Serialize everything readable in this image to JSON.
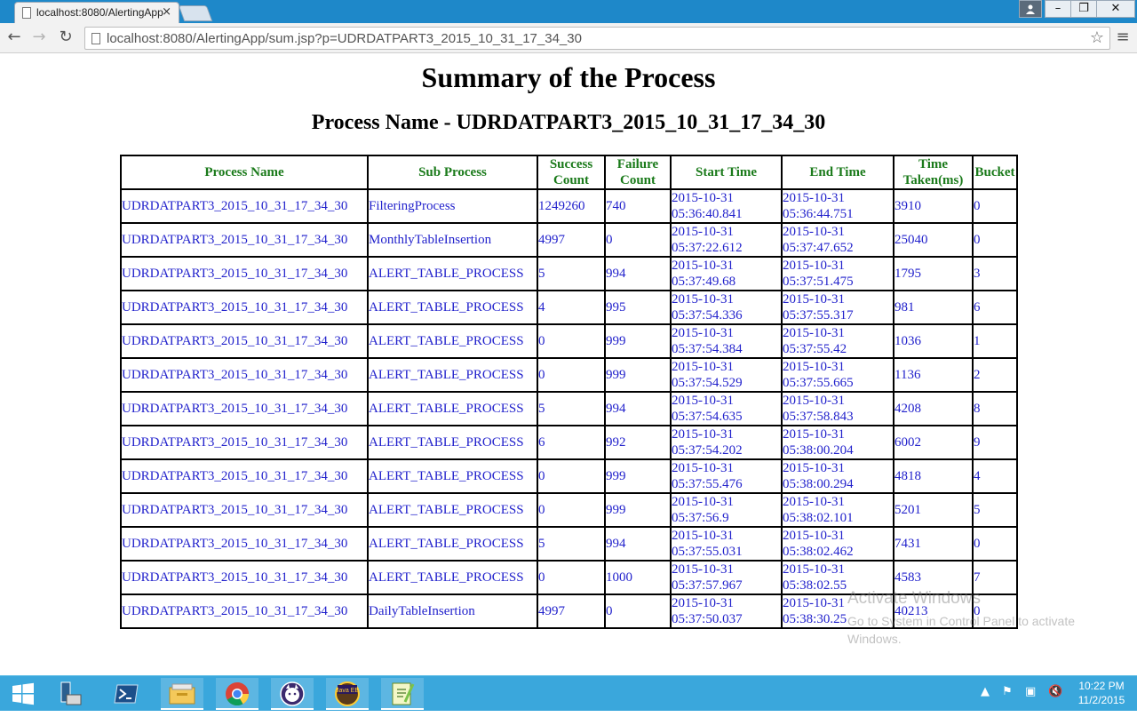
{
  "browser": {
    "tab_title": "localhost:8080/AlertingApp",
    "tab_close": "×",
    "address": "localhost:8080/AlertingApp/sum.jsp?p=UDRDATPART3_2015_10_31_17_34_30",
    "window_controls": {
      "minimize": "–",
      "maximize": "❐",
      "close": "✕"
    },
    "icons": [
      "back-icon",
      "forward-icon",
      "reload-icon",
      "star-icon",
      "menu-icon"
    ]
  },
  "page": {
    "title": "Summary of the Process",
    "subtitle": "Process Name - UDRDATPART3_2015_10_31_17_34_30"
  },
  "table": {
    "headers": [
      "Process Name",
      "Sub Process",
      "Success Count",
      "Failure Count",
      "Start Time",
      "End Time",
      "Time Taken(ms)",
      "Bucket"
    ],
    "header_lines": [
      [
        "Process Name"
      ],
      [
        "Sub Process"
      ],
      [
        "Success",
        "Count"
      ],
      [
        "Failure",
        "Count"
      ],
      [
        "Start Time"
      ],
      [
        "End Time"
      ],
      [
        "Time",
        "Taken(ms)"
      ],
      [
        "Bucket"
      ]
    ],
    "rows": [
      {
        "process": "UDRDATPART3_2015_10_31_17_34_30",
        "sub": "FilteringProcess",
        "success": "1249260",
        "failure": "740",
        "start_date": "2015-10-31",
        "start_time": "05:36:40.841",
        "end_date": "2015-10-31",
        "end_time": "05:36:44.751",
        "taken": "3910",
        "bucket": "0"
      },
      {
        "process": "UDRDATPART3_2015_10_31_17_34_30",
        "sub": "MonthlyTableInsertion",
        "success": "4997",
        "failure": "0",
        "start_date": "2015-10-31",
        "start_time": "05:37:22.612",
        "end_date": "2015-10-31",
        "end_time": "05:37:47.652",
        "taken": "25040",
        "bucket": "0"
      },
      {
        "process": "UDRDATPART3_2015_10_31_17_34_30",
        "sub": "ALERT_TABLE_PROCESS",
        "success": "5",
        "failure": "994",
        "start_date": "2015-10-31",
        "start_time": "05:37:49.68",
        "end_date": "2015-10-31",
        "end_time": "05:37:51.475",
        "taken": "1795",
        "bucket": "3"
      },
      {
        "process": "UDRDATPART3_2015_10_31_17_34_30",
        "sub": "ALERT_TABLE_PROCESS",
        "success": "4",
        "failure": "995",
        "start_date": "2015-10-31",
        "start_time": "05:37:54.336",
        "end_date": "2015-10-31",
        "end_time": "05:37:55.317",
        "taken": "981",
        "bucket": "6"
      },
      {
        "process": "UDRDATPART3_2015_10_31_17_34_30",
        "sub": "ALERT_TABLE_PROCESS",
        "success": "0",
        "failure": "999",
        "start_date": "2015-10-31",
        "start_time": "05:37:54.384",
        "end_date": "2015-10-31",
        "end_time": "05:37:55.42",
        "taken": "1036",
        "bucket": "1"
      },
      {
        "process": "UDRDATPART3_2015_10_31_17_34_30",
        "sub": "ALERT_TABLE_PROCESS",
        "success": "0",
        "failure": "999",
        "start_date": "2015-10-31",
        "start_time": "05:37:54.529",
        "end_date": "2015-10-31",
        "end_time": "05:37:55.665",
        "taken": "1136",
        "bucket": "2"
      },
      {
        "process": "UDRDATPART3_2015_10_31_17_34_30",
        "sub": "ALERT_TABLE_PROCESS",
        "success": "5",
        "failure": "994",
        "start_date": "2015-10-31",
        "start_time": "05:37:54.635",
        "end_date": "2015-10-31",
        "end_time": "05:37:58.843",
        "taken": "4208",
        "bucket": "8"
      },
      {
        "process": "UDRDATPART3_2015_10_31_17_34_30",
        "sub": "ALERT_TABLE_PROCESS",
        "success": "6",
        "failure": "992",
        "start_date": "2015-10-31",
        "start_time": "05:37:54.202",
        "end_date": "2015-10-31",
        "end_time": "05:38:00.204",
        "taken": "6002",
        "bucket": "9"
      },
      {
        "process": "UDRDATPART3_2015_10_31_17_34_30",
        "sub": "ALERT_TABLE_PROCESS",
        "success": "0",
        "failure": "999",
        "start_date": "2015-10-31",
        "start_time": "05:37:55.476",
        "end_date": "2015-10-31",
        "end_time": "05:38:00.294",
        "taken": "4818",
        "bucket": "4"
      },
      {
        "process": "UDRDATPART3_2015_10_31_17_34_30",
        "sub": "ALERT_TABLE_PROCESS",
        "success": "0",
        "failure": "999",
        "start_date": "2015-10-31",
        "start_time": "05:37:56.9",
        "end_date": "2015-10-31",
        "end_time": "05:38:02.101",
        "taken": "5201",
        "bucket": "5"
      },
      {
        "process": "UDRDATPART3_2015_10_31_17_34_30",
        "sub": "ALERT_TABLE_PROCESS",
        "success": "5",
        "failure": "994",
        "start_date": "2015-10-31",
        "start_time": "05:37:55.031",
        "end_date": "2015-10-31",
        "end_time": "05:38:02.462",
        "taken": "7431",
        "bucket": "0"
      },
      {
        "process": "UDRDATPART3_2015_10_31_17_34_30",
        "sub": "ALERT_TABLE_PROCESS",
        "success": "0",
        "failure": "1000",
        "start_date": "2015-10-31",
        "start_time": "05:37:57.967",
        "end_date": "2015-10-31",
        "end_time": "05:38:02.55",
        "taken": "4583",
        "bucket": "7"
      },
      {
        "process": "UDRDATPART3_2015_10_31_17_34_30",
        "sub": "DailyTableInsertion",
        "success": "4997",
        "failure": "0",
        "start_date": "2015-10-31",
        "start_time": "05:37:50.037",
        "end_date": "2015-10-31",
        "end_time": "05:38:30.25",
        "taken": "40213",
        "bucket": "0"
      }
    ]
  },
  "watermark": {
    "line1": "Activate Windows",
    "line2": "Go to System in Control Panel to activate Windows."
  },
  "taskbar": {
    "time": "10:22 PM",
    "date": "11/2/2015",
    "apps": [
      "start-icon",
      "server-manager-icon",
      "powershell-icon",
      "file-explorer-icon",
      "chrome-icon",
      "eclipse-icon",
      "java-ee-icon",
      "notepad-plus-icon"
    ],
    "javaee_label": "Java EE"
  }
}
